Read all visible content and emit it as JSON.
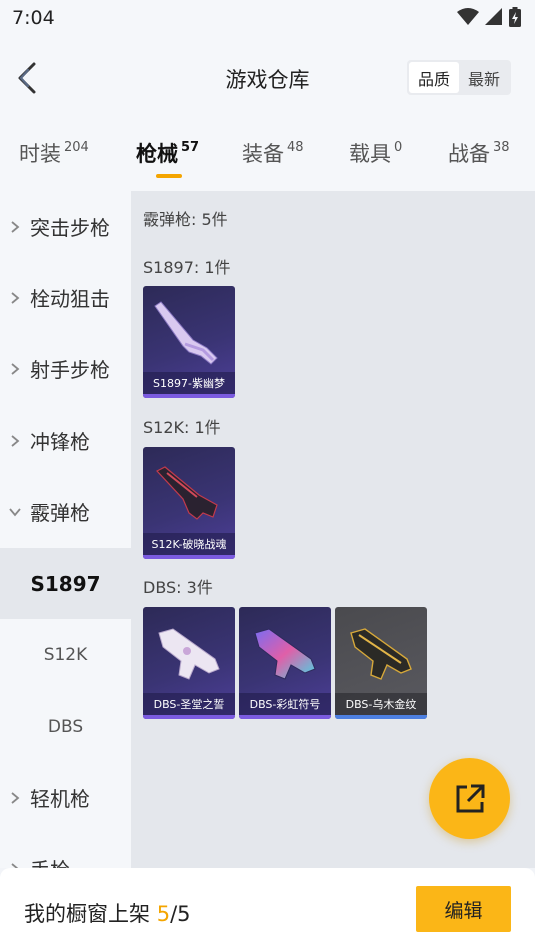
{
  "status": {
    "time": "7:04"
  },
  "header": {
    "title": "游戏仓库",
    "sort_options": [
      "品质",
      "最新"
    ],
    "active_sort": 0
  },
  "tabs": [
    {
      "label": "时装",
      "count": "204"
    },
    {
      "label": "枪械",
      "count": "57"
    },
    {
      "label": "装备",
      "count": "48"
    },
    {
      "label": "载具",
      "count": "0"
    },
    {
      "label": "战备",
      "count": "38"
    }
  ],
  "active_tab": 1,
  "sidebar": {
    "categories": [
      "突击步枪",
      "栓动狙击",
      "射手步枪",
      "冲锋枪",
      "霰弹枪",
      "轻机枪",
      "手枪"
    ],
    "subitems": [
      "S1897",
      "S12K",
      "DBS"
    ],
    "active_category": "霰弹枪",
    "active_subitem": "S1897"
  },
  "content": {
    "category_summary": "霰弹枪: 5件",
    "groups": [
      {
        "title": "S1897: 1件",
        "items": [
          {
            "name": "S1897-紫幽梦"
          }
        ]
      },
      {
        "title": "S12K: 1件",
        "items": [
          {
            "name": "S12K-破晓战魂"
          }
        ]
      },
      {
        "title": "DBS: 3件",
        "items": [
          {
            "name": "DBS-圣堂之誓"
          },
          {
            "name": "DBS-彩虹符号"
          },
          {
            "name": "DBS-乌木金纹"
          }
        ]
      }
    ]
  },
  "bottom": {
    "label": "我的橱窗上架 ",
    "current": "5",
    "total": "/5",
    "edit_label": "编辑"
  },
  "colors": {
    "accent": "#fbb617",
    "tab_underline": "#f4a500",
    "card_purple": "#3a3474",
    "card_bar": "#7b5be0"
  }
}
